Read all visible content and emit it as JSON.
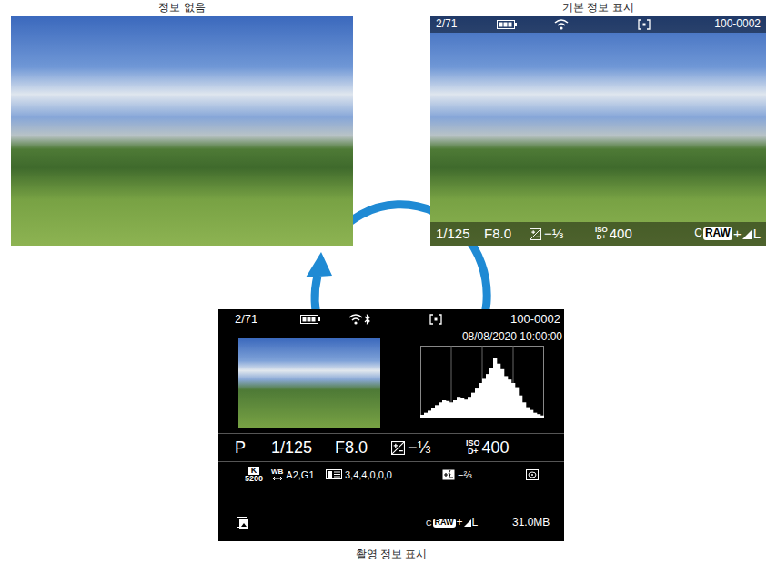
{
  "captions": {
    "top_left": "정보 없음",
    "top_right": "기본 정보 표시",
    "bottom": "촬영 정보 표시"
  },
  "basic_display": {
    "frame": "2/71",
    "file": "100-0002",
    "shutter": "1/125",
    "aperture": "F8.0",
    "exposure_comp": "−⅓",
    "iso_label": "ISO",
    "iso_sub": "D+",
    "iso": "400",
    "quality": {
      "prefix": "C",
      "raw": "RAW",
      "plus": "+",
      "size": "L"
    }
  },
  "shooting_display": {
    "frame": "2/71",
    "file": "100-0002",
    "datetime": "08/08/2020 10:00:00",
    "mode": "P",
    "shutter": "1/125",
    "aperture": "F8.0",
    "exposure_comp": "−⅓",
    "iso_label": "ISO",
    "iso_sub": "D+",
    "iso": "400",
    "color_temp_label": "K",
    "color_temp": "5200",
    "wb_label": "WB",
    "wb_shift": "A2,G1",
    "picture_style": "3,4,4,0,0,0",
    "flash_comp": "−⅔",
    "quality": {
      "prefix": "C",
      "raw": "RAW",
      "plus": "+",
      "size": "L"
    },
    "file_size": "31.0MB",
    "histogram": {
      "values": [
        0.04,
        0.07,
        0.1,
        0.14,
        0.18,
        0.22,
        0.25,
        0.24,
        0.22,
        0.25,
        0.3,
        0.28,
        0.26,
        0.3,
        0.36,
        0.42,
        0.5,
        0.56,
        0.63,
        0.72,
        0.86,
        0.78,
        0.7,
        0.6,
        0.55,
        0.5,
        0.44,
        0.32,
        0.22,
        0.15,
        0.11,
        0.07,
        0.05,
        0.03
      ]
    }
  }
}
